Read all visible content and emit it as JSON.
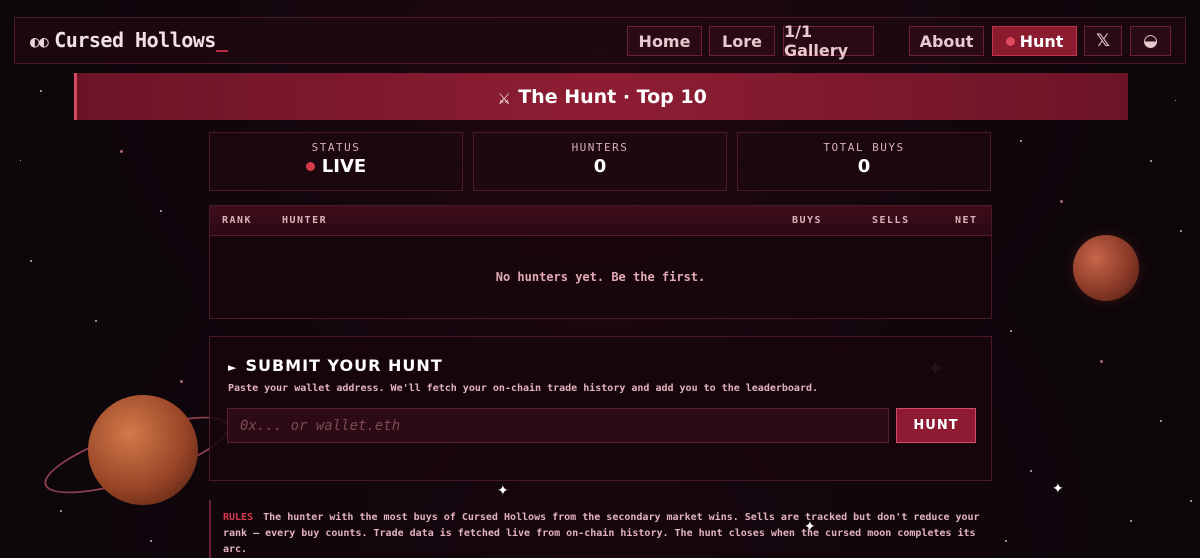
{
  "nav": {
    "brand_eyes": "◐◐",
    "brand": "Cursed Hollows",
    "brand_cursor": "_",
    "links": [
      {
        "label": "Home"
      },
      {
        "label": "Lore"
      },
      {
        "label": "1/1 Gallery"
      },
      {
        "label": "About"
      },
      {
        "label": "Hunt",
        "active": true
      }
    ],
    "x_icon": "𝕏",
    "opensea_icon": "◒"
  },
  "banner": {
    "swords_icon": "⚔",
    "title": "The Hunt · Top 10"
  },
  "stats": {
    "status": {
      "label": "STATUS",
      "value": "LIVE"
    },
    "hunters": {
      "label": "HUNTERS",
      "value": "0"
    },
    "total_buys": {
      "label": "TOTAL BUYS",
      "value": "0"
    }
  },
  "leaderboard": {
    "columns": [
      "RANK",
      "HUNTER",
      "BUYS",
      "SELLS",
      "NET"
    ],
    "empty_text": "No hunters yet. Be the first."
  },
  "submit": {
    "title_arrow": "►",
    "title": "SUBMIT YOUR HUNT",
    "description": "Paste your wallet address. We'll fetch your on-chain trade history and add you to the leaderboard.",
    "input_placeholder": "0x... or wallet.eth",
    "button_label": "HUNT"
  },
  "rules": {
    "tag": "RULES",
    "text": "The hunter with the most buys of Cursed Hollows from the secondary market wins. Sells are tracked but don't reduce your rank — every buy counts. Trade data is fetched live from on-chain history. The hunt closes when the cursed moon completes its arc."
  },
  "colors": {
    "accent": "#8e1b31",
    "live_dot": "#d8384c",
    "background": "#0d060b"
  }
}
